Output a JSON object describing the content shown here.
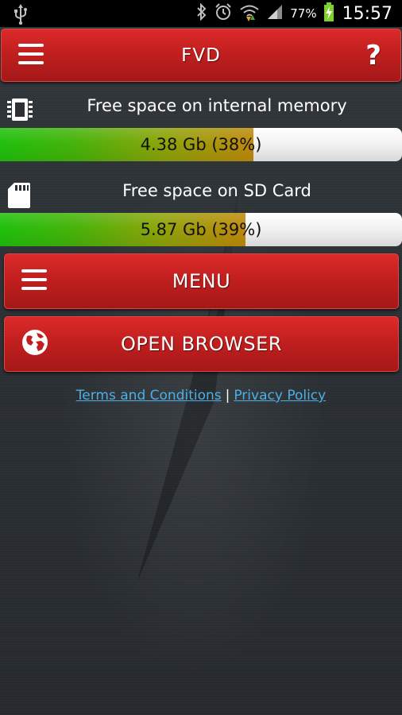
{
  "status_bar": {
    "battery_percent": "77%",
    "time": "15:57",
    "icons": [
      "usb-icon",
      "bluetooth-icon",
      "alarm-icon",
      "wifi-icon",
      "signal-icon",
      "battery-charging-icon"
    ]
  },
  "app_bar": {
    "title": "FVD",
    "left_icon": "hamburger-menu-icon",
    "right_icon": "help-icon",
    "help_glyph": "?"
  },
  "internal_memory": {
    "label": "Free space on internal memory",
    "value_text": "4.38 Gb (38%)",
    "fill_fraction": 0.63,
    "icon": "chip-icon"
  },
  "sd_card": {
    "label": "Free space on SD Card",
    "value_text": "5.87 Gb (39%)",
    "fill_fraction": 0.61,
    "icon": "sd-card-icon"
  },
  "buttons": {
    "menu_label": "MENU",
    "menu_icon": "hamburger-menu-icon",
    "browser_label": "OPEN BROWSER",
    "browser_icon": "globe-icon"
  },
  "links": {
    "terms": "Terms and Conditions",
    "separator": "|",
    "privacy": "Privacy Policy",
    "color": "#4bb0e6"
  },
  "colors": {
    "accent_red": "#c21f1f",
    "progress_green": "#20c00d",
    "progress_orange": "#c08a0c"
  }
}
